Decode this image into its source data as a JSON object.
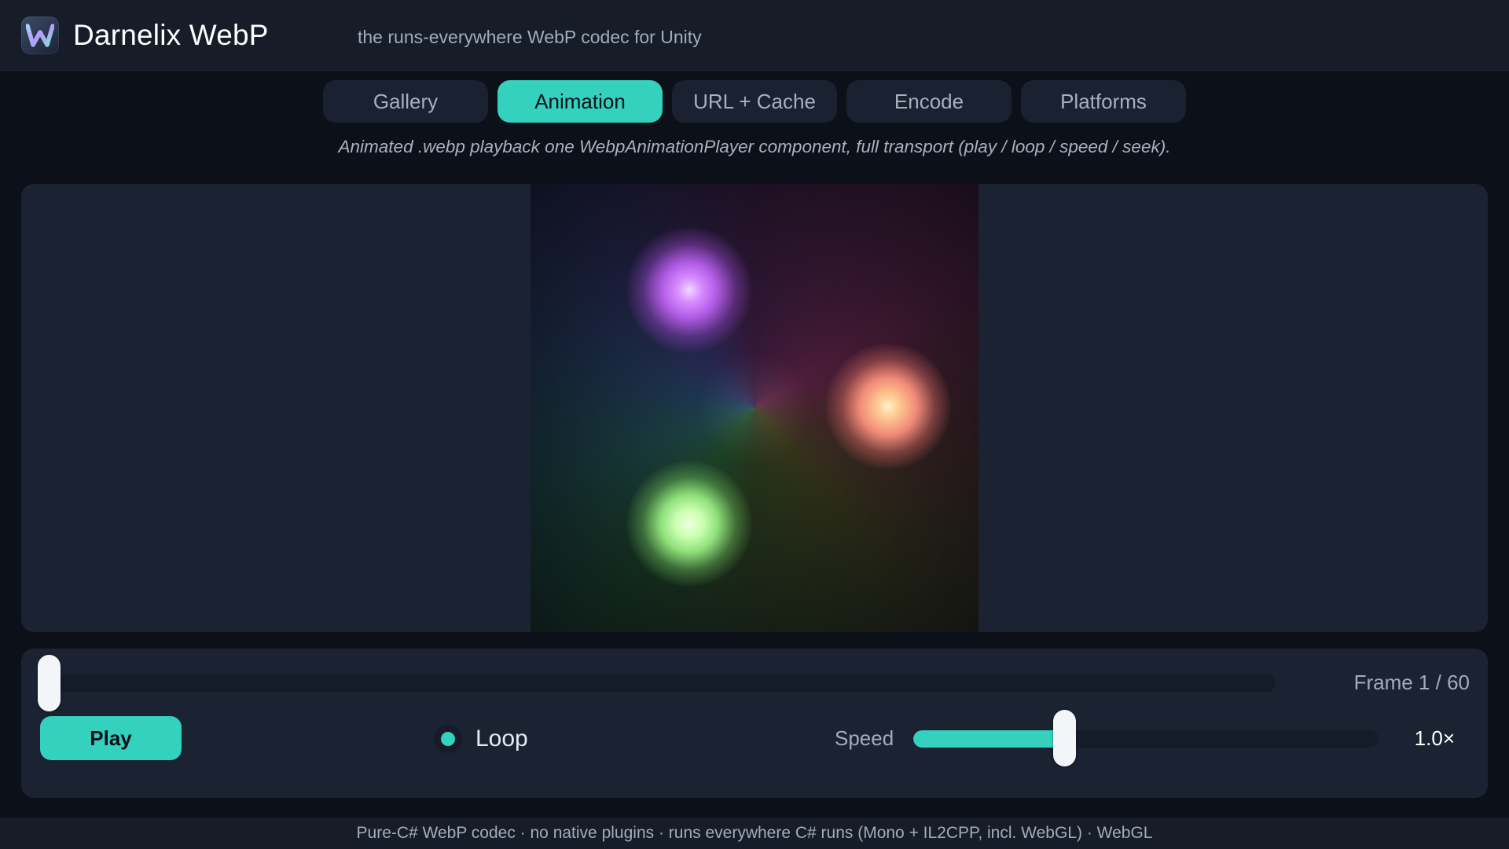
{
  "header": {
    "logo_icon": "w-logo-icon",
    "brand": "Darnelix WebP",
    "tagline": "the runs-everywhere WebP codec for Unity"
  },
  "tabs": [
    {
      "label": "Gallery",
      "active": false
    },
    {
      "label": "Animation",
      "active": true
    },
    {
      "label": "URL + Cache",
      "active": false
    },
    {
      "label": "Encode",
      "active": false
    },
    {
      "label": "Platforms",
      "active": false
    }
  ],
  "subtitle": "Animated .webp playback  one WebpAnimationPlayer component, full transport (play / loop / speed / seek).",
  "controls": {
    "frame_label": "Frame 1 / 60",
    "seek_progress": 0.0,
    "play_label": "Play",
    "loop_label": "Loop",
    "loop_enabled": true,
    "speed_label": "Speed",
    "speed_value": "1.0×",
    "speed_fraction": 0.3
  },
  "footer": "Pure-C# WebP codec · no native plugins · runs everywhere C# runs (Mono + IL2CPP, incl. WebGL) · WebGL",
  "colors": {
    "accent": "#33d1be",
    "background": "#0c1019",
    "panel": "#1b2232",
    "header": "#161c28"
  }
}
